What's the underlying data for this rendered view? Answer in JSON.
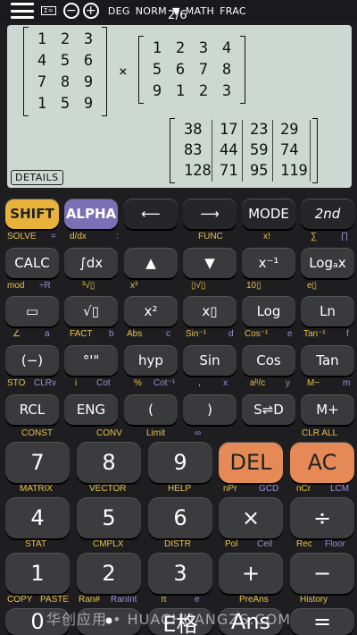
{
  "status": {
    "indicator": "Σ=",
    "minus": "−",
    "plus": "+",
    "deg": "DEG",
    "norm": "NORM",
    "math": "MATH",
    "frac": "FRAC",
    "page": "2/6"
  },
  "display": {
    "m1": [
      [
        "1",
        "2",
        "3"
      ],
      [
        "4",
        "5",
        "6"
      ],
      [
        "7",
        "8",
        "9"
      ],
      [
        "1",
        "5",
        "9"
      ]
    ],
    "mult": "×",
    "m2": [
      [
        "1",
        "2",
        "3",
        "4"
      ],
      [
        "5",
        "6",
        "7",
        "8"
      ],
      [
        "9",
        "1",
        "2",
        "3"
      ]
    ],
    "m3": [
      [
        "38",
        "17",
        "23",
        "29"
      ],
      [
        "83",
        "44",
        "59",
        "74"
      ],
      [
        "128",
        "71",
        "95",
        "119"
      ]
    ],
    "details": "DETAILS"
  },
  "keys": {
    "shift": "SHIFT",
    "alpha": "ALPHA",
    "left": "⟵",
    "right": "⟶",
    "mode": "MODE",
    "second": "2nd",
    "calc": "CALC",
    "integral": "∫dx",
    "up": "▲",
    "down": "▼",
    "inverse": "x⁻¹",
    "log_a": "Logₐx",
    "fraction": "▭",
    "sqrt": "√▯",
    "square": "x²",
    "power": "x▯",
    "log": "Log",
    "ln": "Ln",
    "neg": "(−)",
    "dms": "°'\"",
    "hyp": "hyp",
    "sin": "Sin",
    "cos": "Cos",
    "tan": "Tan",
    "rcl": "RCL",
    "eng": "ENG",
    "lparen": "(",
    "rparen": ")",
    "s_d": "S⇌D",
    "mplus": "M+",
    "seven": "7",
    "eight": "8",
    "nine": "9",
    "del": "DEL",
    "ac": "AC",
    "four": "4",
    "five": "5",
    "six": "6",
    "times": "×",
    "divide": "÷",
    "one": "1",
    "two": "2",
    "three": "3",
    "plus": "+",
    "minus": "−",
    "zero": "0",
    "dot": "•",
    "exp": "E格",
    "ans": "Ans",
    "equals": "="
  },
  "labels": {
    "r1_solve": "SOLVE",
    "r1_eq": "=",
    "r1_ddx": "d/dx",
    "r1_colon": ":",
    "r1_func": "FUNC",
    "r1_fact": "x!",
    "r1_sum": "∑",
    "r1_prod": "∏",
    "r2_mod": "mod",
    "r2_r": "÷R",
    "r2_cbrt": "³√▯",
    "r2_cube": "x³",
    "r2_root": "▯√▯",
    "r2_ten": "10▯",
    "r2_e": "e▯",
    "r3_angle": "∠",
    "r3_a": "a",
    "r3_fact": "FACT",
    "r3_b": "b",
    "r3_abs": "Abs",
    "r3_c": "c",
    "r3_asin": "Sin⁻¹",
    "r3_d": "d",
    "r3_acos": "Cos⁻¹",
    "r3_e": "e",
    "r3_atan": "Tan⁻¹",
    "r3_f": "f",
    "r4_sto": "STO",
    "r4_clrv": "CLRv",
    "r4_i": "i",
    "r4_cot": "Cot",
    "r4_pct": "%",
    "r4_acot": "Cot⁻¹",
    "r4_comma": ",",
    "r4_x": "x",
    "r4_abc": "aᵇ/c",
    "r4_y": "y",
    "r4_mminus": "M−",
    "r4_m": "m",
    "r5_const": "CONST",
    "r5_conv": "CONV",
    "r5_limit": "Limit",
    "r5_inf": "∞",
    "r5_clr": "CLR ALL",
    "r6_matrix": "MATRIX",
    "r6_vector": "VECTOR",
    "r6_help": "HELP",
    "r6_npr": "nPr",
    "r6_gcd": "GCD",
    "r6_ncr": "nCr",
    "r6_lcm": "LCM",
    "r7_stat": "STAT",
    "r7_cmplx": "CMPLX",
    "r7_distr": "DISTR",
    "r7_pol": "Pol",
    "r7_ceil": "Ceil",
    "r7_rec": "Rec",
    "r7_floor": "Floor",
    "r8_copy": "COPY",
    "r8_paste": "PASTE",
    "r8_ran": "Ran#",
    "r8_ranint": "RanInt",
    "r8_pi": "π",
    "r8_e": "e",
    "r8_preans": "PreAns",
    "r8_history": "History"
  },
  "watermark": "华创应用 • HUACHUANGZS.COM",
  "colors": {
    "shift": "#e8b33b",
    "alpha": "#7b6fb5",
    "del": "#e58a57",
    "display": "#cdd8d3"
  }
}
